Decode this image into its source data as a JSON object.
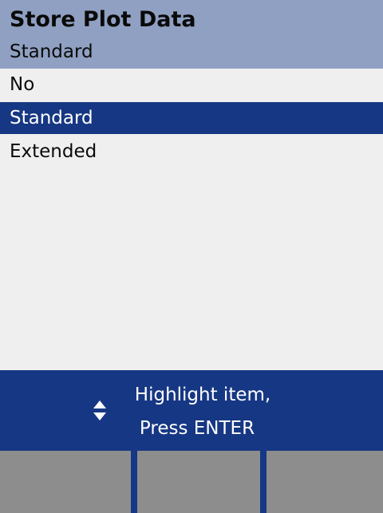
{
  "header": {
    "title": "Store Plot Data",
    "current_value": "Standard"
  },
  "options": [
    {
      "label": "No",
      "selected": false
    },
    {
      "label": "Standard",
      "selected": true
    },
    {
      "label": "Extended",
      "selected": false
    }
  ],
  "hint": {
    "icon": "up-down-arrows-icon",
    "line1": "Highlight item,",
    "line2": "Press ENTER"
  },
  "softkeys": [
    {
      "label": ""
    },
    {
      "label": ""
    },
    {
      "label": ""
    }
  ],
  "colors": {
    "header_bg": "#8fa0c2",
    "list_bg": "#efefef",
    "selection_bg": "#163783",
    "hint_bg": "#163783",
    "softkey_bg": "#8d8d8d"
  }
}
